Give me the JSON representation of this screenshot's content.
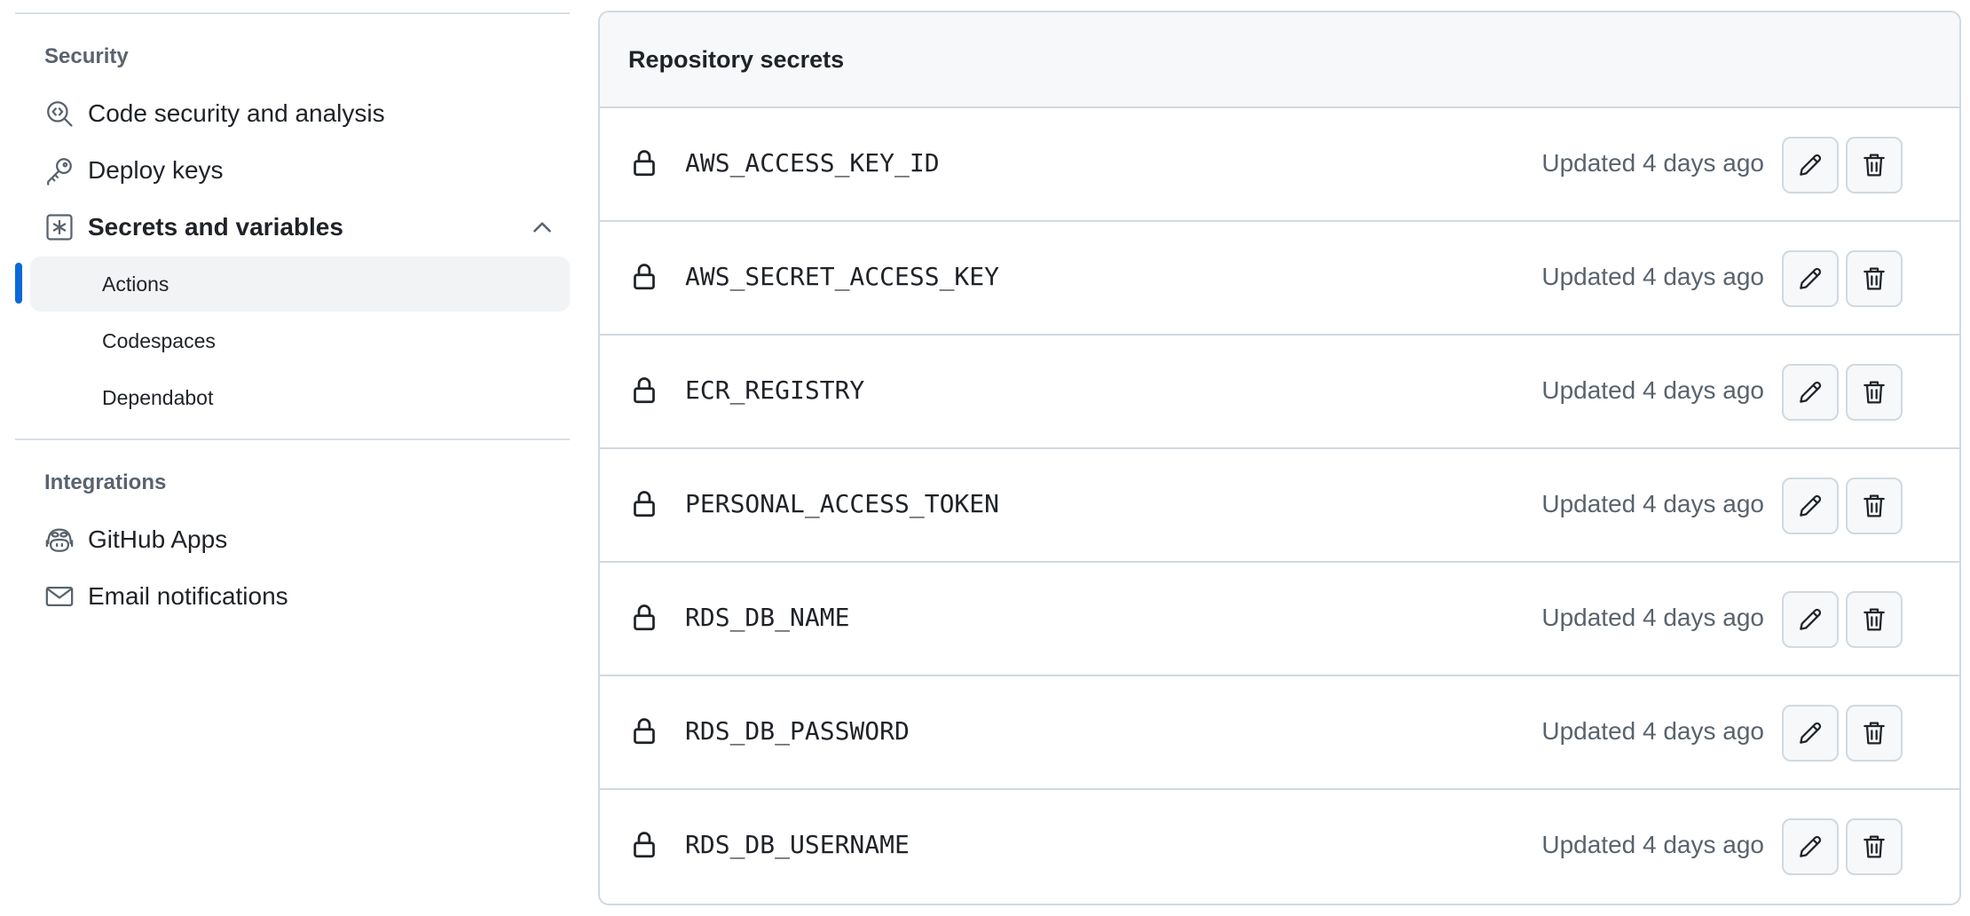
{
  "sidebar": {
    "security_heading": "Security",
    "code_security": "Code security and analysis",
    "deploy_keys": "Deploy keys",
    "secrets_variables": "Secrets and variables",
    "sub": {
      "actions": "Actions",
      "codespaces": "Codespaces",
      "dependabot": "Dependabot"
    },
    "integrations_heading": "Integrations",
    "github_apps": "GitHub Apps",
    "email_notifications": "Email notifications"
  },
  "panel": {
    "title": "Repository secrets",
    "secrets": [
      {
        "name": "AWS_ACCESS_KEY_ID",
        "updated": "Updated 4 days ago"
      },
      {
        "name": "AWS_SECRET_ACCESS_KEY",
        "updated": "Updated 4 days ago"
      },
      {
        "name": "ECR_REGISTRY",
        "updated": "Updated 4 days ago"
      },
      {
        "name": "PERSONAL_ACCESS_TOKEN",
        "updated": "Updated 4 days ago"
      },
      {
        "name": "RDS_DB_NAME",
        "updated": "Updated 4 days ago"
      },
      {
        "name": "RDS_DB_PASSWORD",
        "updated": "Updated 4 days ago"
      },
      {
        "name": "RDS_DB_USERNAME",
        "updated": "Updated 4 days ago"
      }
    ]
  },
  "icons": {
    "code_security": "codescan-icon",
    "deploy_keys": "key-icon",
    "secrets_variables": "asterisk-box-icon",
    "github_apps": "copilot-app-icon",
    "email_notifications": "mail-icon",
    "row_lock": "lock-icon",
    "row_edit": "pencil-icon",
    "row_delete": "trash-icon",
    "expand": "chevron-up-icon"
  },
  "colors": {
    "accent": "#0969da",
    "muted_text": "#59636e",
    "border": "#d1d9e0",
    "active_bg": "#f1f3f5"
  }
}
